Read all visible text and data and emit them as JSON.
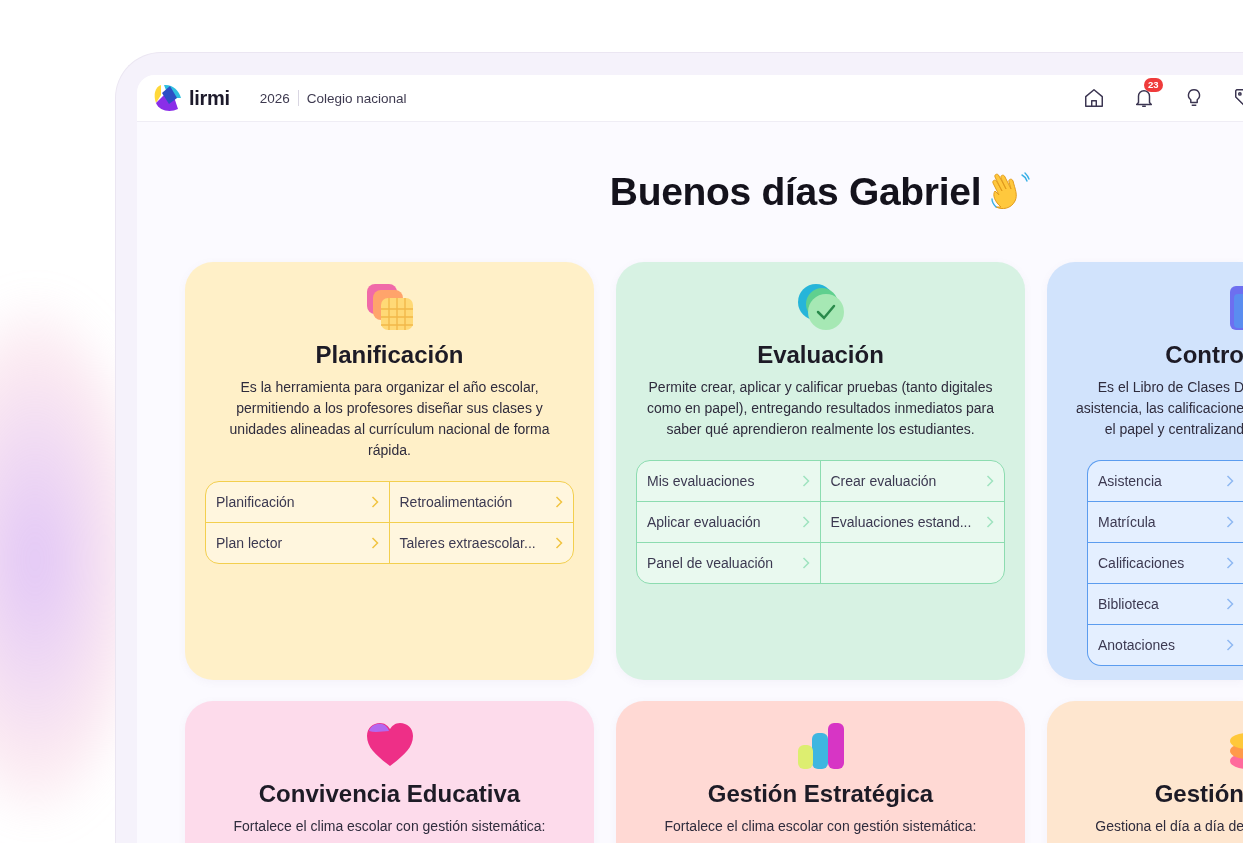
{
  "header": {
    "logo": "lirmi",
    "year": "2026",
    "school": "Colegio nacional",
    "nav": [
      {
        "kind": "home"
      },
      {
        "kind": "bell",
        "badge": "23"
      },
      {
        "kind": "bulb"
      },
      {
        "kind": "tag"
      }
    ]
  },
  "greeting": "Buenos días Gabriel",
  "modules": [
    {
      "kind": "planning",
      "cut": false,
      "title": "Planificación",
      "description": "Es la herramienta para organizar el año escolar, permitiendo a los profesores diseñar sus clases y unidades alineadas al currículum nacional de forma rápida.",
      "links": [
        {
          "label": "Planificación"
        },
        {
          "label": "Retroalimentación"
        },
        {
          "label": "Plan lector"
        },
        {
          "label": "Taleres extraescolar..."
        }
      ]
    },
    {
      "kind": "evaluation",
      "cut": false,
      "title": "Evaluación",
      "description": "Permite crear, aplicar y calificar pruebas (tanto digitales como en papel), entregando resultados inmediatos para saber qué aprendieron realmente los estudiantes.",
      "links": [
        {
          "label": "Mis evaluaciones"
        },
        {
          "label": "Crear evaluación"
        },
        {
          "label": "Aplicar evaluación"
        },
        {
          "label": "Evaluaciones estand..."
        },
        {
          "label": "Panel de vealuación"
        }
      ]
    },
    {
      "kind": "control",
      "cut": true,
      "title": "Contro",
      "description_lines": [
        "Es el Libro de Clases D",
        "asistencia, las calificacione",
        "el papel y centralizand"
      ],
      "links": [
        {
          "label": "Asistencia"
        },
        {
          "label": "Matrícula"
        },
        {
          "label": "Calificaciones"
        },
        {
          "label": "Biblioteca"
        },
        {
          "label": "Anotaciones"
        }
      ]
    },
    {
      "kind": "coexistence",
      "cut": false,
      "title": "Convivencia Educativa",
      "description": "Fortalece el clima escolar con gestión sistemática:"
    },
    {
      "kind": "strategy",
      "cut": false,
      "title": "Gestión Estratégica",
      "description": "Fortalece el clima escolar con gestión sistemática:"
    },
    {
      "kind": "finance",
      "cut": true,
      "title": "Gestión",
      "description_lines": [
        "Gestiona el día a día de"
      ]
    }
  ]
}
